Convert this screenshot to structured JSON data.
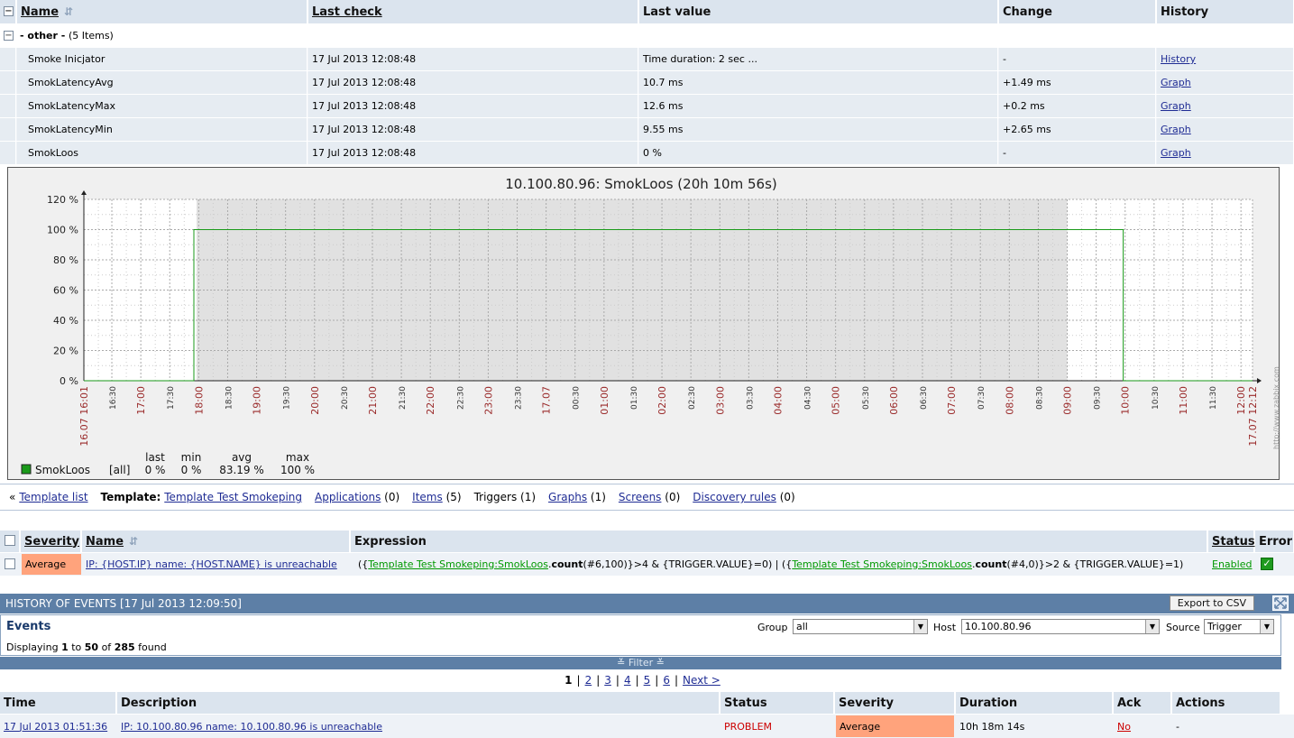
{
  "items_table": {
    "headers": {
      "name": "Name",
      "last_check": "Last check",
      "last_value": "Last value",
      "change": "Change",
      "history": "History"
    },
    "group_label": "- other -",
    "group_count": "(5 Items)",
    "rows": [
      {
        "name": "Smoke Inicjator",
        "last_check": "17 Jul 2013 12:08:48",
        "last_value": "Time duration: 2 sec ...",
        "change": "-",
        "link": "History"
      },
      {
        "name": "SmokLatencyAvg",
        "last_check": "17 Jul 2013 12:08:48",
        "last_value": "10.7 ms",
        "change": "+1.49 ms",
        "link": "Graph"
      },
      {
        "name": "SmokLatencyMax",
        "last_check": "17 Jul 2013 12:08:48",
        "last_value": "12.6 ms",
        "change": "+0.2 ms",
        "link": "Graph"
      },
      {
        "name": "SmokLatencyMin",
        "last_check": "17 Jul 2013 12:08:48",
        "last_value": "9.55 ms",
        "change": "+2.65 ms",
        "link": "Graph"
      },
      {
        "name": "SmokLoos",
        "last_check": "17 Jul 2013 12:08:48",
        "last_value": "0 %",
        "change": "-",
        "link": "Graph"
      }
    ]
  },
  "chart_data": {
    "type": "line",
    "title": "10.100.80.96: SmokLoos (20h 10m 56s)",
    "y_ticks": [
      "0 %",
      "20 %",
      "40 %",
      "60 %",
      "80 %",
      "100 %",
      "120 %"
    ],
    "ylim": [
      0,
      120
    ],
    "x_ticks": [
      "16.07 16:01",
      "16:30",
      "17:00",
      "17:30",
      "18:00",
      "18:30",
      "19:00",
      "19:30",
      "20:00",
      "20:30",
      "21:00",
      "21:30",
      "22:00",
      "22:30",
      "23:00",
      "23:30",
      "17.07",
      "00:30",
      "01:00",
      "01:30",
      "02:00",
      "02:30",
      "03:00",
      "03:30",
      "04:00",
      "04:30",
      "05:00",
      "05:30",
      "06:00",
      "06:30",
      "07:00",
      "07:30",
      "08:00",
      "08:30",
      "09:00",
      "09:30",
      "10:00",
      "10:30",
      "11:00",
      "11:30",
      "12:00",
      "17.07 12:12"
    ],
    "red_ticks": [
      "16.07 16:01",
      "17:00",
      "18:00",
      "19:00",
      "20:00",
      "21:00",
      "22:00",
      "23:00",
      "17.07",
      "01:00",
      "02:00",
      "03:00",
      "04:00",
      "05:00",
      "06:00",
      "07:00",
      "08:00",
      "09:00",
      "10:00",
      "11:00",
      "12:00",
      "17.07 12:12"
    ],
    "series": [
      {
        "name": "SmokLoos",
        "color": "#1a9a1a",
        "points": [
          [
            "16.07 16:01",
            0
          ],
          [
            "16.07 17:55",
            0
          ],
          [
            "16.07 17:55",
            100
          ],
          [
            "17.07 09:58",
            100
          ],
          [
            "17.07 09:58",
            0
          ],
          [
            "17.07 12:12",
            0
          ]
        ]
      }
    ],
    "legend": {
      "name": "SmokLoos",
      "scope": "[all]",
      "last_label": "last",
      "min_label": "min",
      "avg_label": "avg",
      "max_label": "max",
      "last": "0 %",
      "min": "0 %",
      "avg": "83.19 %",
      "max": "100 %"
    },
    "watermark": "http://www.zabbix.com",
    "grid": true
  },
  "nav": {
    "prefix": "«",
    "template_list": "Template list",
    "template_label": "Template:",
    "template_name": "Template Test Smokeping",
    "applications": "Applications",
    "applications_count": "(0)",
    "items": "Items",
    "items_count": "(5)",
    "triggers": "Triggers",
    "triggers_count": "(1)",
    "graphs": "Graphs",
    "graphs_count": "(1)",
    "screens": "Screens",
    "screens_count": "(0)",
    "discovery": "Discovery rules",
    "discovery_count": "(0)"
  },
  "triggers_table": {
    "headers": {
      "severity": "Severity",
      "name": "Name",
      "expression": "Expression",
      "status": "Status",
      "error": "Error"
    },
    "row": {
      "severity": "Average",
      "name": "IP: {HOST.IP} name: {HOST.NAME} is unreachable",
      "expr_p1": "({",
      "expr_link1": "Template Test Smokeping:SmokLoos",
      "expr_p2": ".",
      "expr_fn1": "count",
      "expr_p3": "(#6,100)}>4 & {TRIGGER.VALUE}=0) | ({",
      "expr_link2": "Template Test Smokeping:SmokLoos",
      "expr_p4": ".",
      "expr_fn2": "count",
      "expr_p5": "(#4,0)}>2 & {TRIGGER.VALUE}=1)",
      "status": "Enabled"
    }
  },
  "history": {
    "bar_title": "HISTORY OF EVENTS [17 Jul 2013 12:09:50]",
    "export_label": "Export to CSV",
    "events_title": "Events",
    "displaying": "Displaying",
    "from": "1",
    "to_word": "to",
    "to": "50",
    "of_word": "of",
    "total": "285",
    "found": "found",
    "group_label": "Group",
    "group_value": "all",
    "host_label": "Host",
    "host_value": "10.100.80.96",
    "source_label": "Source",
    "source_value": "Trigger",
    "filter_label": "Filter",
    "pages": [
      "1",
      "2",
      "3",
      "4",
      "5",
      "6"
    ],
    "next_label": "Next >"
  },
  "events_table": {
    "headers": {
      "time": "Time",
      "description": "Description",
      "status": "Status",
      "severity": "Severity",
      "duration": "Duration",
      "ack": "Ack",
      "actions": "Actions"
    },
    "row": {
      "time": "17 Jul 2013 01:51:36",
      "description": "IP: 10.100.80.96 name: 10.100.80.96 is unreachable",
      "status": "PROBLEM",
      "severity": "Average",
      "duration": "10h 18m 14s",
      "ack": "No",
      "actions": "-"
    }
  },
  "colors": {
    "header_bg": "#dbe4ee",
    "average_severity": "#ffa37c",
    "problem": "#cc0000",
    "enabled": "#009900",
    "bar_blue": "#5d7fa6"
  }
}
